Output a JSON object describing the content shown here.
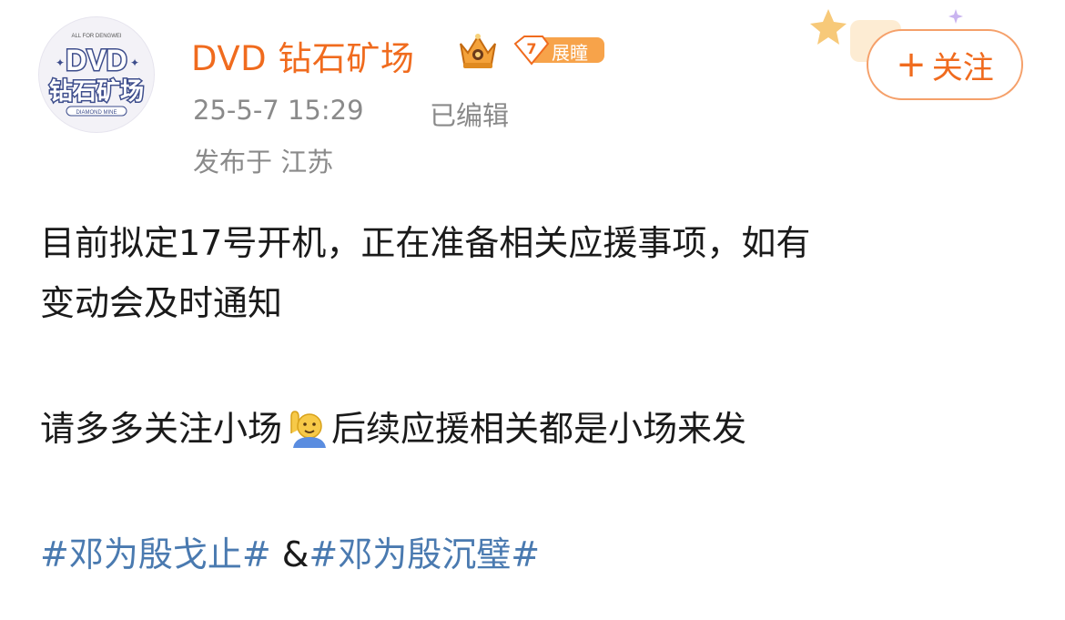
{
  "user": {
    "avatar_text_top": "DVD",
    "avatar_text_cn": "钻石矿场",
    "avatar_small_top": "ALL FOR DENGWEI",
    "avatar_small_bottom": "DIAMOND MINE",
    "name": "DVD 钻石矿场",
    "level_number": "7",
    "level_label": "展瞳"
  },
  "follow_button": {
    "plus": "+",
    "label": "关注"
  },
  "meta": {
    "time": "25-5-7 15:29",
    "edited": "已编辑",
    "location": "发布于 江苏"
  },
  "post": {
    "line1": "目前拟定17号开机，正在准备相关应援事项，如有",
    "line2": "变动会及时通知",
    "line3_before": "请多多关注小场",
    "line3_after": "后续应援相关都是小场来发",
    "emoji_name": "raising-hand-emoji",
    "hashtag1": "#邓为殷戈止#",
    "amp": " &",
    "hashtag2": "#邓为殷沉璧#"
  },
  "colors": {
    "username": "#f06b1e",
    "hashtag": "#4a7ab0",
    "meta": "#8a8a8a",
    "follow_border": "#f5a06a"
  }
}
